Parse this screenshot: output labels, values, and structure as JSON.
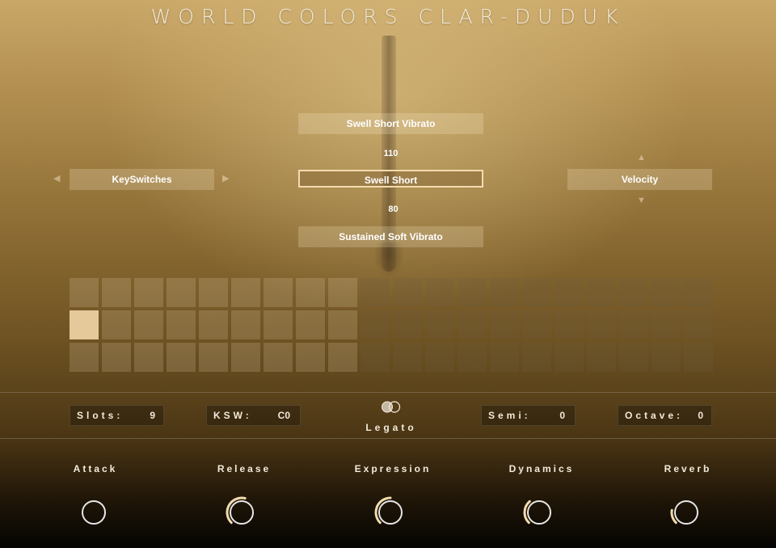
{
  "title": "WORLD COLORS CLAR-DUDUK",
  "articulations": {
    "prev": "Swell Short Vibrato",
    "prev_value": "110",
    "current": "Swell Short",
    "next_value": "80",
    "next": "Sustained Soft Vibrato"
  },
  "left_selector": {
    "label": "KeySwitches"
  },
  "right_selector": {
    "label": "Velocity"
  },
  "grid": {
    "columns": 20,
    "rows": 3,
    "active_columns": 9,
    "selected_row": 2,
    "selected_col": 1
  },
  "params": {
    "slots": {
      "label": "Slots:",
      "value": "9"
    },
    "ksw": {
      "label": "KSW:",
      "value": "C0"
    },
    "legato": {
      "label": "Legato"
    },
    "semi": {
      "label": "Semi:",
      "value": "0"
    },
    "octave": {
      "label": "Octave:",
      "value": "0"
    }
  },
  "knobs": [
    {
      "label": "Attack",
      "level": 0.0
    },
    {
      "label": "Release",
      "level": 0.55
    },
    {
      "label": "Expression",
      "level": 0.5
    },
    {
      "label": "Dynamics",
      "level": 0.35
    },
    {
      "label": "Reverb",
      "level": 0.2
    }
  ],
  "colors": {
    "accent": "#f3dcae",
    "selected_cell": "#e5c99a",
    "text": "#f3eadb"
  }
}
